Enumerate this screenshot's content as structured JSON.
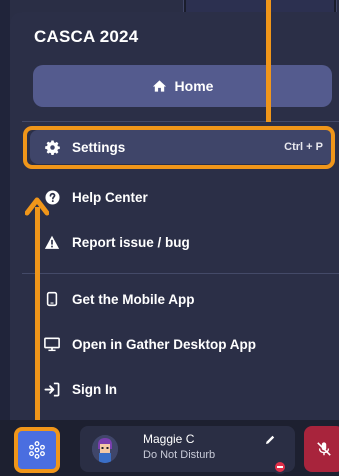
{
  "panel": {
    "title": "CASCA 2024",
    "home_label": "Home"
  },
  "menu": {
    "items": [
      {
        "label": "Settings",
        "shortcut": "Ctrl + P",
        "icon": "gear-icon"
      },
      {
        "label": "Help Center",
        "icon": "question-circle-icon"
      },
      {
        "label": "Report issue / bug",
        "icon": "warning-icon"
      },
      {
        "label": "Get the Mobile App",
        "icon": "mobile-phone-icon"
      },
      {
        "label": "Open in Gather Desktop App",
        "icon": "monitor-icon"
      },
      {
        "label": "Sign In",
        "icon": "sign-in-icon"
      }
    ]
  },
  "user": {
    "name": "Maggie C",
    "status": "Do Not Disturb"
  },
  "colors": {
    "accent_orange": "#f0961a",
    "panel_bg": "#2b2f47",
    "home_button": "#545b8e",
    "grid_button": "#4a6ee0",
    "mic_muted": "#a8243c",
    "dnd_red": "#e0304a"
  }
}
